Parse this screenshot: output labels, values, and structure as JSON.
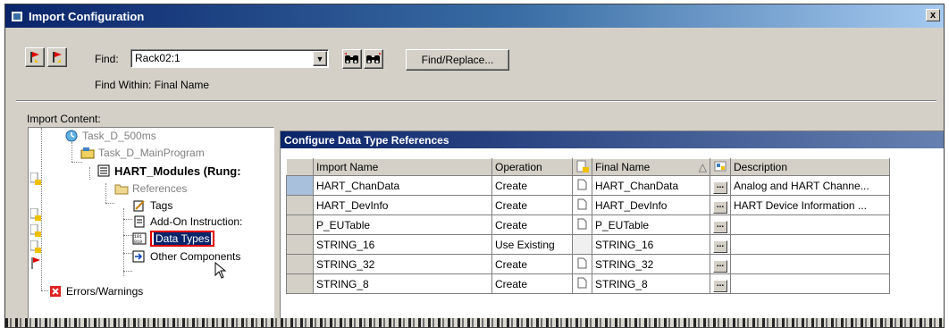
{
  "window": {
    "title": "Import Configuration",
    "close_label": "x",
    "icons": [
      "app-icon",
      "close-icon"
    ]
  },
  "toolbar": {
    "find_label": "Find:",
    "find_value": "Rack02:1",
    "find_replace_label": "Find/Replace...",
    "find_within": "Find Within: Final Name",
    "icons": [
      "previous-flag-icon",
      "next-flag-icon",
      "find-previous-binoculars-icon",
      "find-next-binoculars-icon",
      "dropdown-arrow-icon"
    ]
  },
  "import_content": {
    "label": "Import Content:",
    "tree": [
      {
        "label": "Task_D_500ms",
        "icon": "task-icon",
        "style": "gray"
      },
      {
        "label": "Task_D_MainProgram",
        "icon": "program-icon",
        "style": "gray"
      },
      {
        "label": "HART_Modules (Rung:",
        "icon": "routine-icon",
        "style": "bold"
      },
      {
        "label": "References",
        "icon": "folder-icon",
        "style": "gray"
      },
      {
        "label": "Tags",
        "icon": "tags-icon",
        "style": "normal"
      },
      {
        "label": "Add-On Instruction:",
        "icon": "add-on-icon",
        "style": "normal"
      },
      {
        "label": "Data Types",
        "icon": "data-types-icon",
        "style": "selected"
      },
      {
        "label": "Other Components",
        "icon": "other-components-icon",
        "style": "normal"
      },
      {
        "label": "Errors/Warnings",
        "icon": "error-icon",
        "style": "normal"
      }
    ]
  },
  "references_panel": {
    "title": "Configure Data Type References",
    "columns": [
      "Import Name",
      "Operation",
      "",
      "Final Name",
      "",
      "Description"
    ],
    "sort_indicator": "△",
    "rows": [
      {
        "import_name": "HART_ChanData",
        "operation": "Create",
        "final_name": "HART_ChanData",
        "description": "Analog and HART Channe..."
      },
      {
        "import_name": "HART_DevInfo",
        "operation": "Create",
        "final_name": "HART_DevInfo",
        "description": "HART Device Information ..."
      },
      {
        "import_name": "P_EUTable",
        "operation": "Create",
        "final_name": "P_EUTable",
        "description": ""
      },
      {
        "import_name": "STRING_16",
        "operation": "Use Existing",
        "final_name": "STRING_16",
        "description": ""
      },
      {
        "import_name": "STRING_32",
        "operation": "Create",
        "final_name": "STRING_32",
        "description": ""
      },
      {
        "import_name": "STRING_8",
        "operation": "Create",
        "final_name": "STRING_8",
        "description": ""
      }
    ]
  },
  "colors": {
    "title_bar": "#0a246a",
    "selection": "#0a246a",
    "highlight_box": "#e00000",
    "face": "#d4d0c8"
  }
}
